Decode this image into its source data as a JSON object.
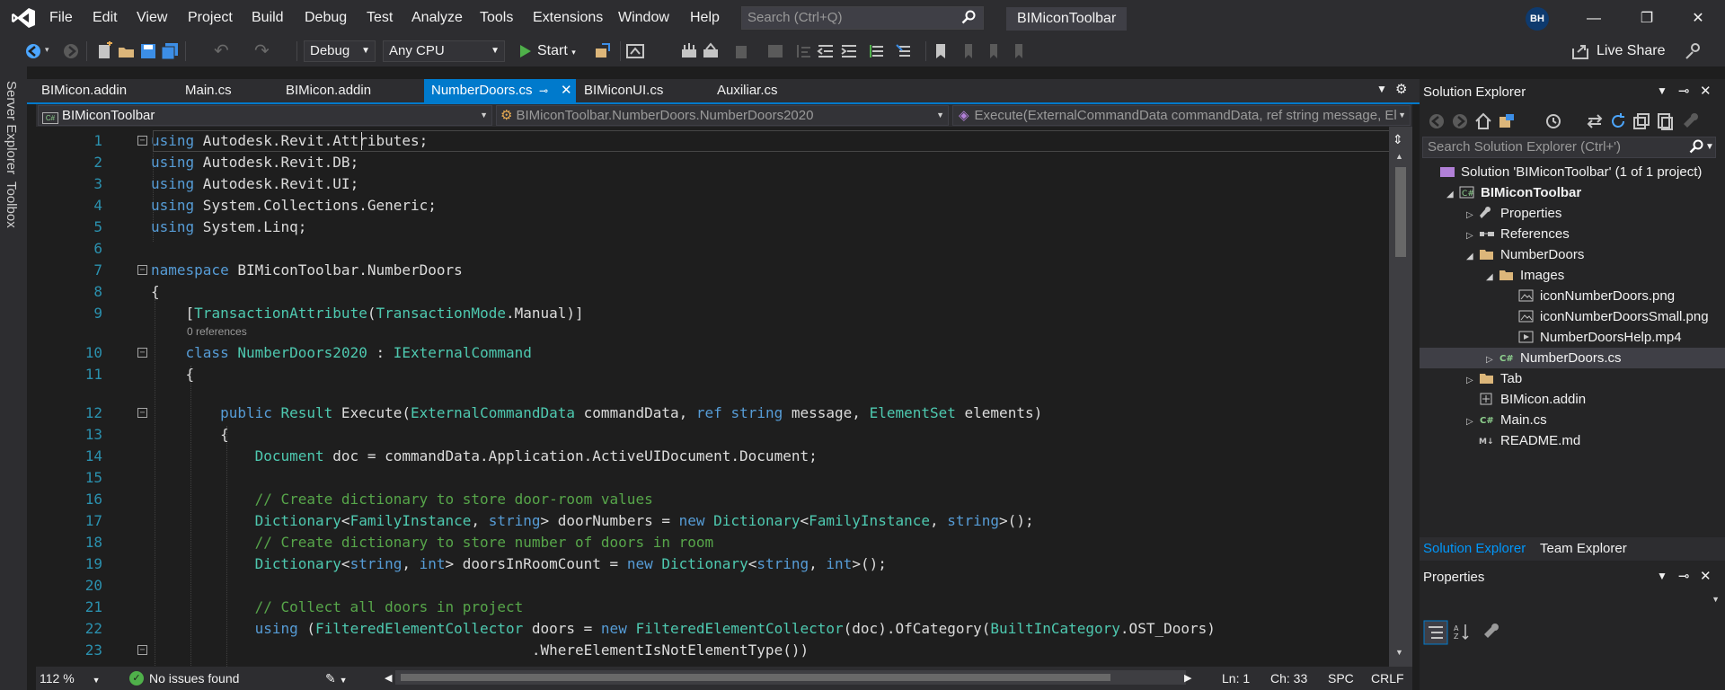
{
  "menu": [
    "File",
    "Edit",
    "View",
    "Project",
    "Build",
    "Debug",
    "Test",
    "Analyze",
    "Tools",
    "Extensions",
    "Window",
    "Help"
  ],
  "search": {
    "placeholder": "Search (Ctrl+Q)"
  },
  "solution_title": "BIMiconToolbar",
  "user_initials": "BH",
  "toolbar": {
    "config": "Debug",
    "platform": "Any CPU",
    "start_label": "Start",
    "live_share_label": "Live Share"
  },
  "side_tabs": [
    "Server Explorer",
    "Toolbox"
  ],
  "doc_tabs": [
    {
      "label": "BIMicon.addin",
      "active": false
    },
    {
      "label": "Main.cs",
      "active": false
    },
    {
      "label": "BIMicon.addin",
      "active": false
    },
    {
      "label": "NumberDoors.cs",
      "active": true
    },
    {
      "label": "BIMiconUI.cs",
      "active": false
    },
    {
      "label": "Auxiliar.cs",
      "active": false
    }
  ],
  "navbar": {
    "project": "BIMiconToolbar",
    "class": "BIMiconToolbar.NumberDoors.NumberDoors2020",
    "member": "Execute(ExternalCommandData commandData, ref string message, El"
  },
  "code": {
    "references_label": "0 references",
    "lines": [
      {
        "n": "1",
        "t": "using Autodesk.Revit.Attributes;"
      },
      {
        "n": "2",
        "t": "using Autodesk.Revit.DB;"
      },
      {
        "n": "3",
        "t": "using Autodesk.Revit.UI;"
      },
      {
        "n": "4",
        "t": "using System.Collections.Generic;"
      },
      {
        "n": "5",
        "t": "using System.Linq;"
      },
      {
        "n": "6",
        "t": ""
      },
      {
        "n": "7",
        "t": "namespace BIMiconToolbar.NumberDoors"
      },
      {
        "n": "8",
        "t": "{"
      },
      {
        "n": "9",
        "t": "    [TransactionAttribute(TransactionMode.Manual)]"
      },
      {
        "n": "10",
        "t": "    class NumberDoors2020 : IExternalCommand"
      },
      {
        "n": "11",
        "t": "    {"
      },
      {
        "n": "12",
        "t": "        public Result Execute(ExternalCommandData commandData, ref string message, ElementSet elements)"
      },
      {
        "n": "13",
        "t": "        {"
      },
      {
        "n": "14",
        "t": "            Document doc = commandData.Application.ActiveUIDocument.Document;"
      },
      {
        "n": "15",
        "t": ""
      },
      {
        "n": "16",
        "t": "            // Create dictionary to store door-room values"
      },
      {
        "n": "17",
        "t": "            Dictionary<FamilyInstance, string> doorNumbers = new Dictionary<FamilyInstance, string>();"
      },
      {
        "n": "18",
        "t": "            // Create dictionary to store number of doors in room"
      },
      {
        "n": "19",
        "t": "            Dictionary<string, int> doorsInRoomCount = new Dictionary<string, int>();"
      },
      {
        "n": "20",
        "t": ""
      },
      {
        "n": "21",
        "t": "            // Collect all doors in project"
      },
      {
        "n": "22",
        "t": "            using (FilteredElementCollector doors = new FilteredElementCollector(doc).OfCategory(BuiltInCategory.OST_Doors)"
      },
      {
        "n": "23",
        "t": "                                            .WhereElementIsNotElementType())"
      }
    ]
  },
  "status": {
    "zoom": "112 %",
    "issues": "No issues found",
    "line": "Ln: 1",
    "col": "Ch: 33",
    "indent": "SPC",
    "eol": "CRLF"
  },
  "solution_explorer": {
    "title": "Solution Explorer",
    "search_placeholder": "Search Solution Explorer (Ctrl+')",
    "tree": [
      {
        "label": "Solution 'BIMiconToolbar' (1 of 1 project)",
        "depth": 0,
        "tri": "",
        "icon": "solution-icon",
        "bold": false
      },
      {
        "label": "BIMiconToolbar",
        "depth": 1,
        "tri": "◢",
        "icon": "csharp-project-icon",
        "bold": true
      },
      {
        "label": "Properties",
        "depth": 2,
        "tri": "▷",
        "icon": "wrench-icon",
        "bold": false
      },
      {
        "label": "References",
        "depth": 2,
        "tri": "▷",
        "icon": "references-icon",
        "bold": false
      },
      {
        "label": "NumberDoors",
        "depth": 2,
        "tri": "◢",
        "icon": "folder-open-icon",
        "bold": false
      },
      {
        "label": "Images",
        "depth": 3,
        "tri": "◢",
        "icon": "folder-open-icon",
        "bold": false
      },
      {
        "label": "iconNumberDoors.png",
        "depth": 4,
        "tri": "",
        "icon": "image-file-icon",
        "bold": false
      },
      {
        "label": "iconNumberDoorsSmall.png",
        "depth": 4,
        "tri": "",
        "icon": "image-file-icon",
        "bold": false
      },
      {
        "label": "NumberDoorsHelp.mp4",
        "depth": 4,
        "tri": "",
        "icon": "video-file-icon",
        "bold": false
      },
      {
        "label": "NumberDoors.cs",
        "depth": 3,
        "tri": "▷",
        "icon": "csharp-file-icon",
        "bold": false,
        "selected": true
      },
      {
        "label": "Tab",
        "depth": 2,
        "tri": "▷",
        "icon": "folder-icon",
        "bold": false
      },
      {
        "label": "BIMicon.addin",
        "depth": 2,
        "tri": "",
        "icon": "addin-file-icon",
        "bold": false
      },
      {
        "label": "Main.cs",
        "depth": 2,
        "tri": "▷",
        "icon": "csharp-file-icon",
        "bold": false
      },
      {
        "label": "README.md",
        "depth": 2,
        "tri": "",
        "icon": "markdown-file-icon",
        "bold": false
      }
    ],
    "tabs": [
      {
        "label": "Solution Explorer",
        "active": true
      },
      {
        "label": "Team Explorer",
        "active": false
      }
    ]
  },
  "properties_panel": {
    "title": "Properties"
  },
  "colors": {
    "accent": "#007acc",
    "keyword": "#569cd6",
    "type": "#4ec9b0",
    "comment": "#57a64a",
    "line_number": "#2b91af"
  }
}
